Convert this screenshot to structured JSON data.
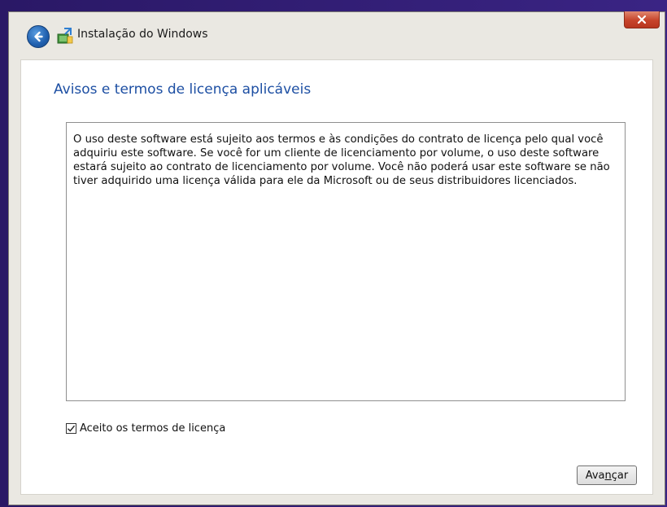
{
  "window": {
    "title": "Instalação do Windows",
    "close_glyph": "X"
  },
  "icons": {
    "back": "back-arrow-icon",
    "app": "windows-setup-icon",
    "close": "close-icon",
    "check": "check-icon"
  },
  "page": {
    "heading": "Avisos e termos de licença aplicáveis",
    "license_text": "O uso deste software está sujeito aos termos e às condições do contrato de licença pelo qual você adquiriu este software. Se você for um cliente de licenciamento por volume, o uso deste software estará sujeito ao contrato de licenciamento por volume. Você não poderá usar este software se não tiver adquirido uma licença válida para ele da Microsoft ou de seus distribuidores licenciados."
  },
  "accept": {
    "label": "Aceito os termos de licença",
    "checked": true
  },
  "buttons": {
    "next_pre": "Ava",
    "next_underline": "n",
    "next_post": "çar"
  },
  "colors": {
    "heading": "#1d4fa3",
    "close_button": "#c7442b",
    "desktop": "#2c1b6e"
  }
}
